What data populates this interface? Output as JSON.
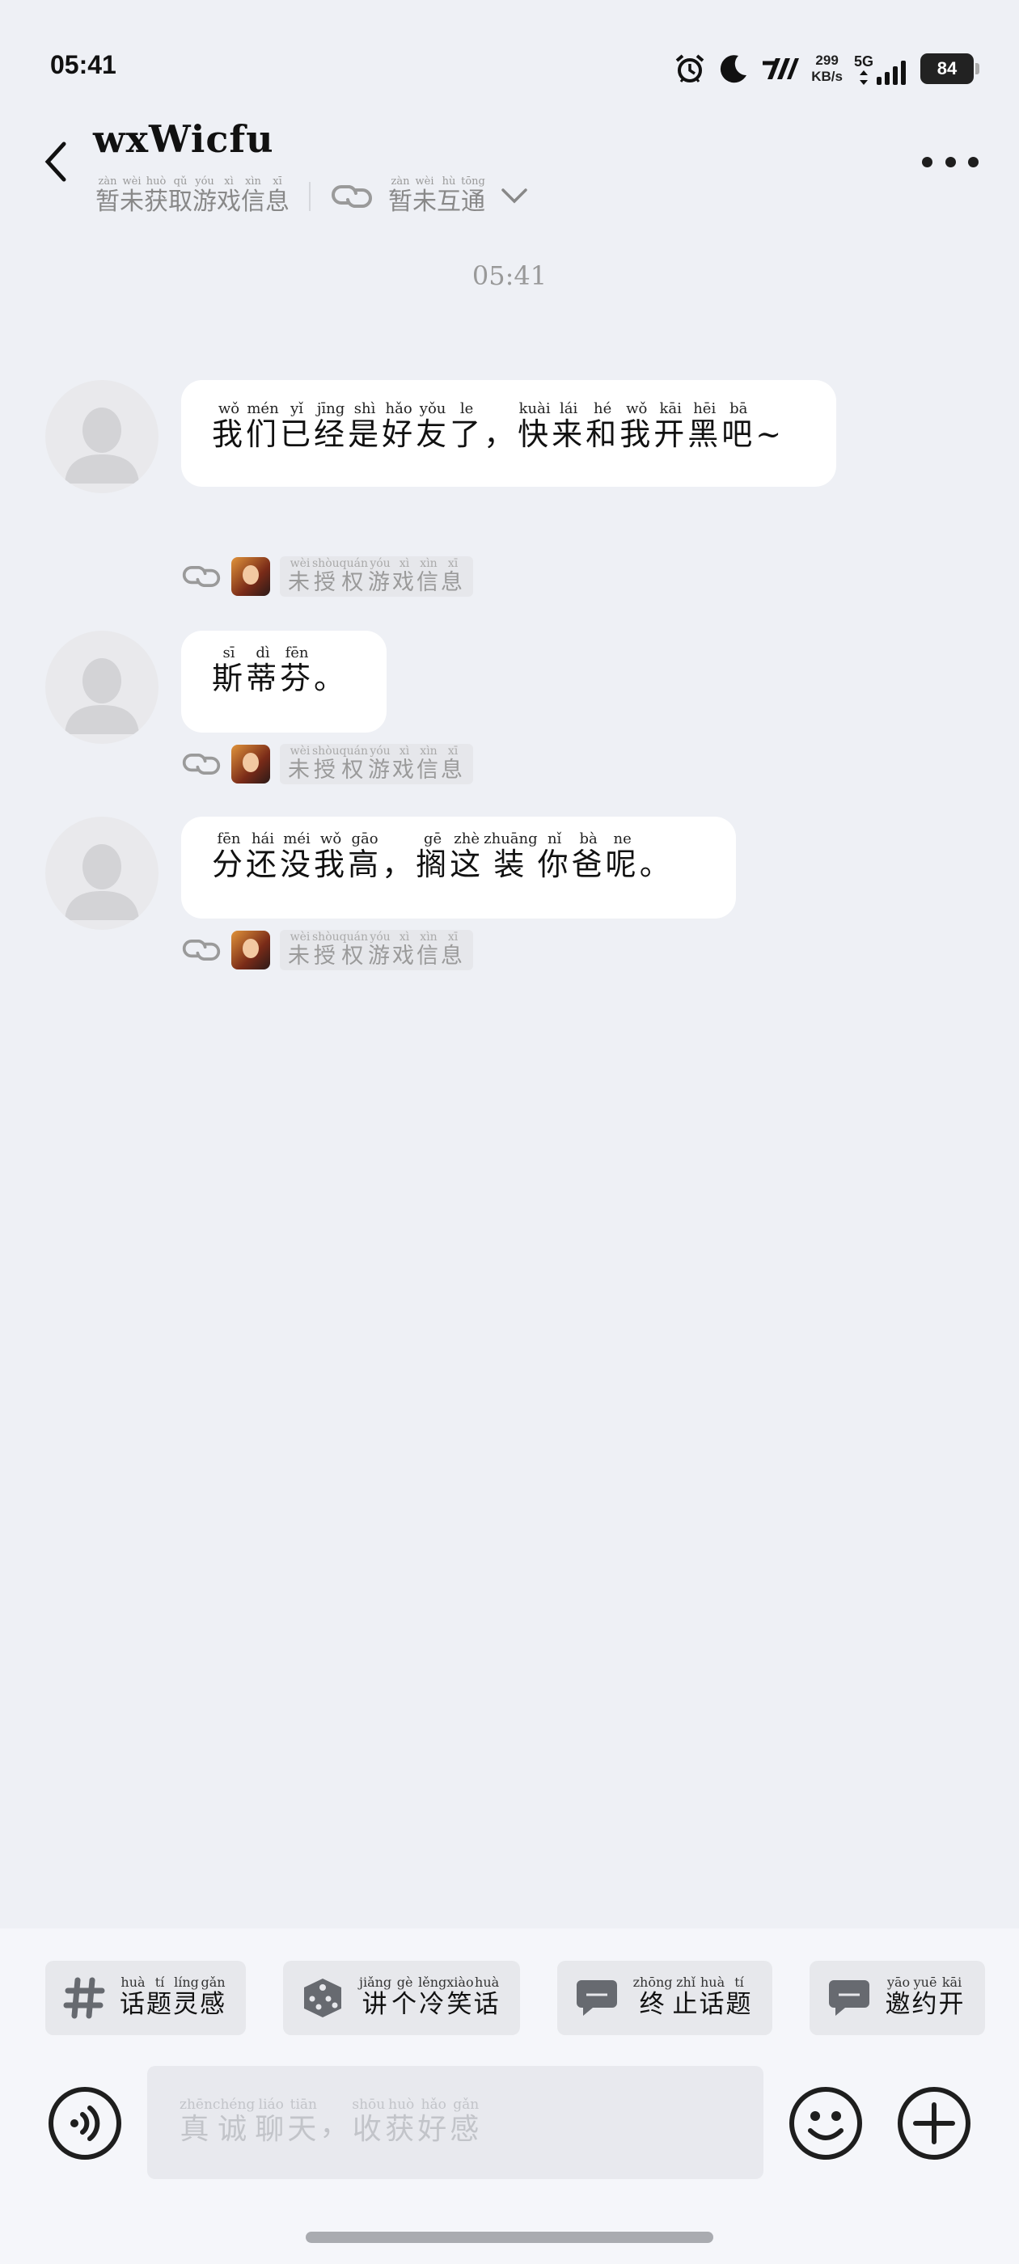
{
  "status_bar": {
    "time": "05:41",
    "net_speed_value": "299",
    "net_speed_unit": "KB/s",
    "network": "5G",
    "battery": "84"
  },
  "header": {
    "title": "wxWicfu",
    "left_status": [
      [
        "暂",
        "zàn"
      ],
      [
        "未",
        "wèi"
      ],
      [
        "获",
        "huò"
      ],
      [
        "取",
        "qǔ"
      ],
      [
        "游",
        "yóu"
      ],
      [
        "戏",
        "xì"
      ],
      [
        "信",
        "xìn"
      ],
      [
        "息",
        "xī"
      ]
    ],
    "right_status": [
      [
        "暂",
        "zàn"
      ],
      [
        "未",
        "wèi"
      ],
      [
        "互",
        "hù"
      ],
      [
        "通",
        "tōng"
      ]
    ]
  },
  "time_divider": "05:41",
  "messages": [
    {
      "ruby": [
        [
          "我",
          "wǒ"
        ],
        [
          "们",
          "mén"
        ],
        [
          "已",
          "yǐ"
        ],
        [
          "经",
          "jīng"
        ],
        [
          "是",
          "shì"
        ],
        [
          "好",
          "hǎo"
        ],
        [
          "友",
          "yǒu"
        ],
        [
          "了",
          "le"
        ],
        [
          "，",
          ""
        ],
        [
          "快",
          "kuài"
        ],
        [
          "来",
          "lái"
        ],
        [
          "和",
          "hé"
        ],
        [
          "我",
          "wǒ"
        ],
        [
          "开",
          "kāi"
        ],
        [
          "黑",
          "hēi"
        ],
        [
          "吧",
          "bā"
        ],
        [
          "~",
          ""
        ]
      ],
      "game_tag": [
        [
          "未",
          "wèi"
        ],
        [
          "授",
          "shòu"
        ],
        [
          "权",
          "quán"
        ],
        [
          "游",
          "yóu"
        ],
        [
          "戏",
          "xì"
        ],
        [
          "信",
          "xìn"
        ],
        [
          "息",
          "xī"
        ]
      ]
    },
    {
      "ruby": [
        [
          "斯",
          "sī"
        ],
        [
          "蒂",
          "dì"
        ],
        [
          "芬",
          "fēn"
        ],
        [
          "。",
          ""
        ]
      ],
      "game_tag": [
        [
          "未",
          "wèi"
        ],
        [
          "授",
          "shòu"
        ],
        [
          "权",
          "quán"
        ],
        [
          "游",
          "yóu"
        ],
        [
          "戏",
          "xì"
        ],
        [
          "信",
          "xìn"
        ],
        [
          "息",
          "xī"
        ]
      ]
    },
    {
      "ruby": [
        [
          "分",
          "fēn"
        ],
        [
          "还",
          "hái"
        ],
        [
          "没",
          "méi"
        ],
        [
          "我",
          "wǒ"
        ],
        [
          "高",
          "gāo"
        ],
        [
          "，",
          ""
        ],
        [
          "搁",
          "gē"
        ],
        [
          "这",
          "zhè"
        ],
        [
          "装",
          "zhuāng"
        ],
        [
          "你",
          "nǐ"
        ],
        [
          "爸",
          "bà"
        ],
        [
          "呢",
          "ne"
        ],
        [
          "。",
          ""
        ]
      ],
      "game_tag": [
        [
          "未",
          "wèi"
        ],
        [
          "授",
          "shòu"
        ],
        [
          "权",
          "quán"
        ],
        [
          "游",
          "yóu"
        ],
        [
          "戏",
          "xì"
        ],
        [
          "信",
          "xìn"
        ],
        [
          "息",
          "xī"
        ]
      ]
    }
  ],
  "chips": [
    {
      "icon": "hashtag-icon",
      "ruby": [
        [
          "话",
          "huà"
        ],
        [
          "题",
          "tí"
        ],
        [
          "灵",
          "líng"
        ],
        [
          "感",
          "gǎn"
        ]
      ]
    },
    {
      "icon": "dice-icon",
      "ruby": [
        [
          "讲",
          "jiǎng"
        ],
        [
          "个",
          "gè"
        ],
        [
          "冷",
          "lěng"
        ],
        [
          "笑",
          "xiào"
        ],
        [
          "话",
          "huà"
        ]
      ]
    },
    {
      "icon": "chat-bubble-icon",
      "ruby": [
        [
          "终",
          "zhōng"
        ],
        [
          "止",
          "zhǐ"
        ],
        [
          "话",
          "huà"
        ],
        [
          "题",
          "tí"
        ]
      ]
    },
    {
      "icon": "chat-bubble-icon",
      "ruby": [
        [
          "邀",
          "yāo"
        ],
        [
          "约",
          "yuē"
        ],
        [
          "开",
          "kāi"
        ]
      ]
    }
  ],
  "input": {
    "placeholder_ruby": [
      [
        "真",
        "zhēn"
      ],
      [
        "诚",
        "chéng"
      ],
      [
        "聊",
        "liáo"
      ],
      [
        "天",
        "tiān"
      ],
      [
        "，",
        ""
      ],
      [
        "收",
        "shōu"
      ],
      [
        "获",
        "huò"
      ],
      [
        "好",
        "hǎo"
      ],
      [
        "感",
        "gǎn"
      ]
    ]
  },
  "colors": {
    "background": "#eef0f5",
    "bubble": "#ffffff",
    "panel": "#f5f6fa",
    "chip": "#e7e8ec"
  }
}
